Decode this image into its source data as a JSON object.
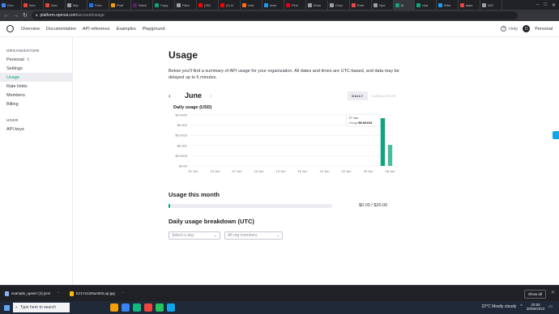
{
  "browser": {
    "tabs": [
      {
        "label": "Goo",
        "color": "#4285f4"
      },
      {
        "label": "Inbo",
        "color": "#ea4335"
      },
      {
        "label": "Inbo",
        "color": "#ea4335"
      },
      {
        "label": "http",
        "color": "#9aa0a6"
      },
      {
        "label": "Feec",
        "color": "#1877f2"
      },
      {
        "label": "Profi",
        "color": "#f59e0b"
      },
      {
        "label": "Slack",
        "color": "#611f69"
      },
      {
        "label": "Copy",
        "color": "#10a37f"
      },
      {
        "label": "Pitch",
        "color": "#9aa0a6"
      },
      {
        "label": "(332",
        "color": "#ff0000"
      },
      {
        "label": "(1) N",
        "color": "#ff0000"
      },
      {
        "label": "Untr",
        "color": "#f97316"
      },
      {
        "label": "Ame",
        "color": "#1d9bf0"
      },
      {
        "label": "Pine",
        "color": "#e60023"
      },
      {
        "label": "Exan",
        "color": "#9aa0a6"
      },
      {
        "label": "Choc",
        "color": "#9aa0a6"
      },
      {
        "label": "Emb",
        "color": "#ef4444"
      },
      {
        "label": "Ope",
        "color": "#9aa0a6"
      },
      {
        "label": "U",
        "color": "#10a37f",
        "active": true
      },
      {
        "label": "Usa",
        "color": "#10a37f"
      },
      {
        "label": "Whe",
        "color": "#1d9bf0"
      },
      {
        "label": "aske",
        "color": "#ef4444"
      },
      {
        "label": "429",
        "color": "#9aa0a6"
      }
    ],
    "url_host": "platform.openai.com",
    "url_path": "/account/usage"
  },
  "topnav": {
    "links": [
      "Overview",
      "Documentation",
      "API reference",
      "Examples",
      "Playground"
    ],
    "help": "Help",
    "avatar_initial": "D",
    "account": "Personal"
  },
  "sidebar": {
    "org_heading": "ORGANIZATION",
    "org_items": [
      "Personal",
      "Settings",
      "Usage",
      "Rate limits",
      "Members",
      "Billing"
    ],
    "user_heading": "USER",
    "user_items": [
      "API keys"
    ]
  },
  "page": {
    "title": "Usage",
    "description": "Below you'll find a summary of API usage for your organization. All dates and times are UTC-based, and data may be delayed up to 5 minutes.",
    "month": "June",
    "toggle_daily": "DAILY",
    "toggle_cumulative": "CUMULATIVE",
    "chart_title": "Daily usage (USD)",
    "tooltip_date": "27 Jun",
    "tooltip_label": "Usage:",
    "tooltip_value": "$0.00234",
    "usage_month_heading": "Usage this month",
    "usage_progress_fraction": 0.005,
    "usage_amount": "$0.00 / $20.00",
    "breakdown_heading": "Daily usage breakdown (UTC)",
    "select_day_placeholder": "Select a day",
    "members_placeholder": "All org members"
  },
  "chart_data": {
    "type": "bar",
    "x": [
      "01 Jun",
      "02 Jun",
      "03 Jun",
      "04 Jun",
      "05 Jun",
      "06 Jun",
      "07 Jun",
      "08 Jun",
      "09 Jun",
      "10 Jun",
      "11 Jun",
      "12 Jun",
      "13 Jun",
      "14 Jun",
      "15 Jun",
      "16 Jun",
      "17 Jun",
      "18 Jun",
      "19 Jun",
      "20 Jun",
      "21 Jun",
      "22 Jun",
      "23 Jun",
      "24 Jun",
      "25 Jun",
      "26 Jun",
      "27 Jun",
      "28 Jun"
    ],
    "values": [
      0,
      0,
      0,
      0,
      0,
      0,
      0,
      0,
      0,
      0,
      0,
      0,
      0,
      0,
      0,
      0,
      0,
      0,
      0,
      0,
      0,
      0,
      0,
      0,
      0,
      0,
      0.00234,
      0.00103
    ],
    "xticks": [
      "01 Jun",
      "04 Jun",
      "07 Jun",
      "10 Jun",
      "13 Jun",
      "16 Jun",
      "19 Jun",
      "22 Jun",
      "25 Jun",
      "28 Jun"
    ],
    "yticks": [
      "$0.00",
      "$0.0005",
      "$0.001",
      "$0.0015",
      "$0.002",
      "$0.0025"
    ],
    "ylim": [
      0,
      0.0025
    ],
    "title": "Daily usage (USD)",
    "highlight": "27 Jun",
    "color": "#10a37f",
    "highlight_color": "#10a37f"
  },
  "downloads": {
    "files": [
      "example_upsert (2).json",
      "Ez1Ycn3XwABXLvp.jpg"
    ],
    "show_all": "Show all"
  },
  "taskbar": {
    "search_placeholder": "Type here to search",
    "weather": "22°C  Mostly cloudy",
    "time": "20:55",
    "date": "28/06/2023",
    "apps": [
      "#f59e0b",
      "#3b82f6",
      "#10b981",
      "#ef4444",
      "#22c55e",
      "#0ea5e9"
    ]
  }
}
